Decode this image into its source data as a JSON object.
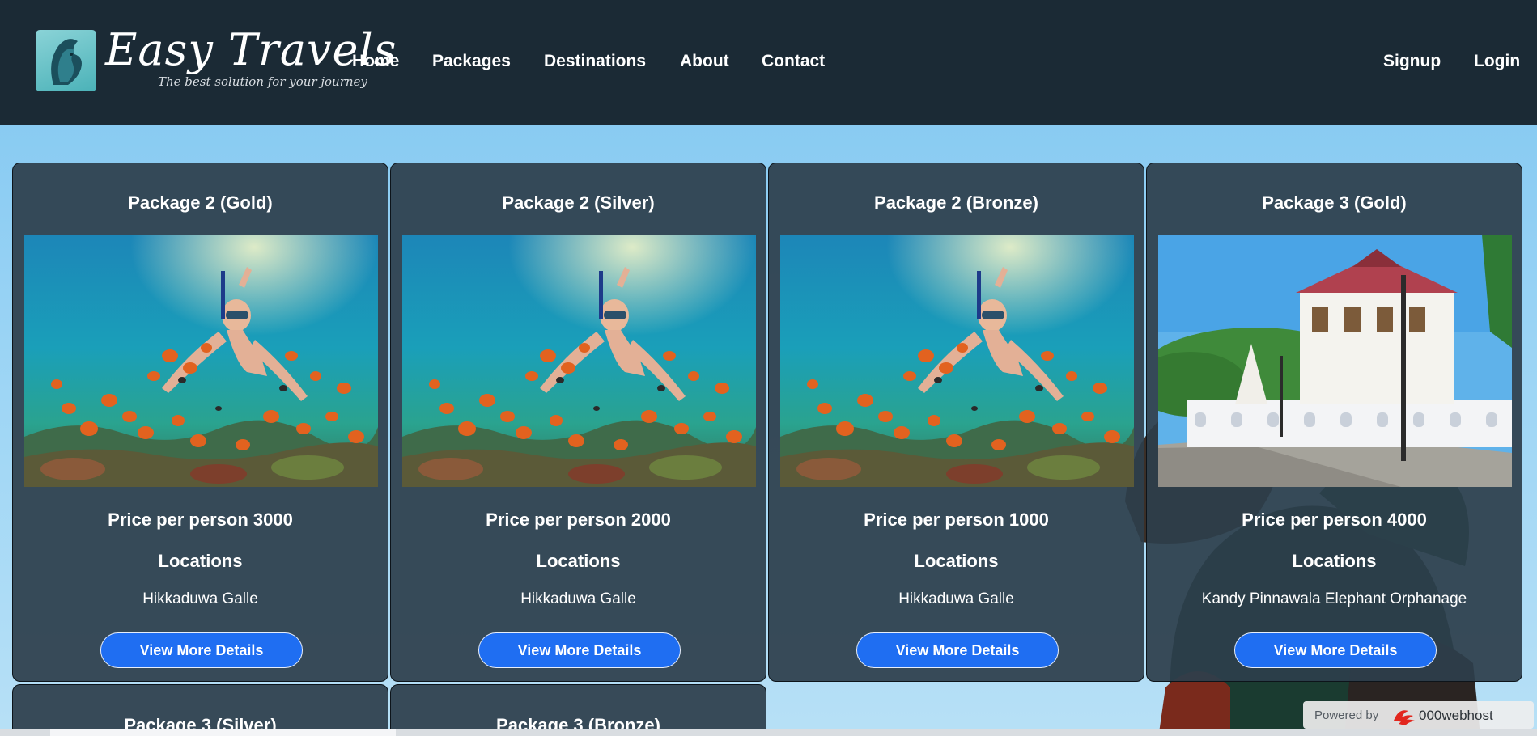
{
  "brand": {
    "title": "Easy Travels",
    "tagline": "The best solution for your journey",
    "logo_icon": "lion-head-logo"
  },
  "nav": {
    "home": "Home",
    "packages": "Packages",
    "destinations": "Destinations",
    "about": "About",
    "contact": "Contact",
    "signup": "Signup",
    "login": "Login"
  },
  "cards": [
    {
      "title": "Package 2 (Gold)",
      "image": "snorkeling-reef",
      "price": "Price per person 3000",
      "locations_heading": "Locations",
      "locations": "Hikkaduwa Galle",
      "button": "View More Details"
    },
    {
      "title": "Package 2 (Silver)",
      "image": "snorkeling-reef",
      "price": "Price per person 2000",
      "locations_heading": "Locations",
      "locations": "Hikkaduwa Galle",
      "button": "View More Details"
    },
    {
      "title": "Package 2 (Bronze)",
      "image": "snorkeling-reef",
      "price": "Price per person 1000",
      "locations_heading": "Locations",
      "locations": "Hikkaduwa Galle",
      "button": "View More Details"
    },
    {
      "title": "Package 3 (Gold)",
      "image": "temple-of-the-tooth",
      "price": "Price per person 4000",
      "locations_heading": "Locations",
      "locations": "Kandy Pinnawala Elephant Orphanage",
      "button": "View More Details"
    },
    {
      "title": "Package 3 (Silver)"
    },
    {
      "title": "Package 3 (Bronze)"
    }
  ],
  "footer_badge": {
    "label": "Powered by",
    "brand": "000webhost"
  },
  "colors": {
    "header_bg": "#1b2a35",
    "card_bg": "#2d3e4b",
    "button_bg": "#1f6ef2",
    "page_bg": "#87c9ee"
  }
}
